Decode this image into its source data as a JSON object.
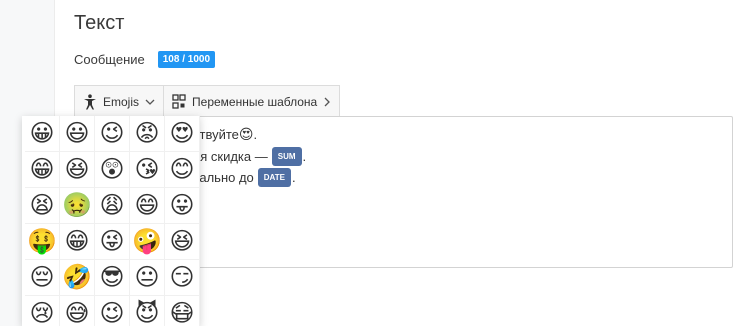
{
  "title": "Текст",
  "message": {
    "label": "Сообщение",
    "counter": "108 / 1000"
  },
  "toolbar": {
    "emojis_label": "Emojis",
    "variables_label": "Переменные шаблона"
  },
  "editor": {
    "line1": {
      "text": "ствуйте",
      "emoji": "😍",
      "tail": "."
    },
    "line2": {
      "text": "ая скидка — ",
      "tag": "SUM",
      "tail": "."
    },
    "line3": {
      "text": "уально до ",
      "tag": "DATE",
      "tail": "."
    }
  },
  "emojis": [
    "😀",
    "😃",
    "😉",
    "😡",
    "😍",
    "😁",
    "😆",
    "😲",
    "😘",
    "😊",
    "😫",
    "🤢",
    "😩",
    "😄",
    "😛",
    "🤑",
    "😁",
    "😜",
    "🤪",
    "😆",
    "😔",
    "🤣",
    "😎",
    "😐",
    "😏",
    "😢",
    "😅",
    "😉",
    "😈",
    "😷"
  ],
  "colors": {
    "accent": "#2196f3",
    "tag_bg": "#4f6fa4"
  }
}
